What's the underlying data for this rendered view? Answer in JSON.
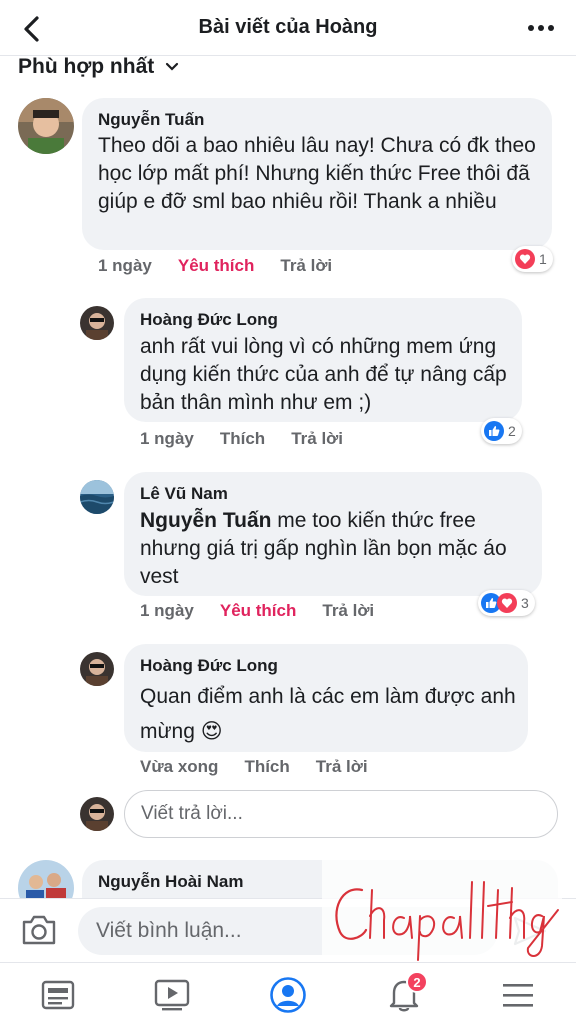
{
  "header": {
    "title": "Bài viết của Hoàng",
    "back_icon": "chevron-left-icon",
    "more_icon": "more-horizontal-icon"
  },
  "sort": {
    "label": "Phù hợp nhất",
    "icon": "chevron-down-icon"
  },
  "comments": [
    {
      "name": "Nguyễn Tuấn",
      "text": "Theo dõi a bao nhiêu lâu nay! Chưa có đk theo học lớp mất phí! Nhưng kiến thức Free thôi đã giúp e đỡ sml bao nhiêu rồi! Thank a nhiều",
      "time": "1 ngày",
      "like_label": "Yêu thích",
      "reply_label": "Trả lời",
      "reaction_count": "1",
      "reactions": [
        "love"
      ]
    },
    {
      "name": "Hoàng Đức Long",
      "text": "anh rất vui lòng vì có những mem ứng dụng kiến thức của anh để tự nâng cấp bản thân mình như em ;)",
      "time": "1 ngày",
      "like_label": "Thích",
      "reply_label": "Trả lời",
      "reaction_count": "2",
      "reactions": [
        "like"
      ]
    },
    {
      "name": "Lê Vũ Nam",
      "mention": "Nguyễn Tuấn",
      "text": " me too kiến thức free nhưng giá trị gấp nghìn lần bọn mặc áo vest",
      "time": "1 ngày",
      "like_label": "Yêu thích",
      "reply_label": "Trả lời",
      "reaction_count": "3",
      "reactions": [
        "like",
        "love"
      ]
    },
    {
      "name": "Hoàng Đức Long",
      "text": "Quan điểm anh là các em làm được anh mừng",
      "emoji": "😍",
      "time": "Vừa xong",
      "like_label": "Thích",
      "reply_label": "Trả lời"
    },
    {
      "name": "Nguyễn Hoài Nam"
    }
  ],
  "reply_box": {
    "placeholder": "Viết trả lời..."
  },
  "composer": {
    "placeholder": "Viết bình luận...",
    "camera_icon": "camera-icon",
    "send_icon": "send-icon"
  },
  "tabbar": {
    "items": [
      "news-feed-icon",
      "watch-icon",
      "profile-icon",
      "notifications-icon",
      "menu-icon"
    ],
    "notification_count": "2"
  },
  "watermark": {
    "text": "Chapalthay"
  },
  "colors": {
    "like_blue": "#1877f2",
    "love_red": "#f33e58",
    "liked_text": "#e0245e",
    "bubble_bg": "#f0f2f5"
  }
}
